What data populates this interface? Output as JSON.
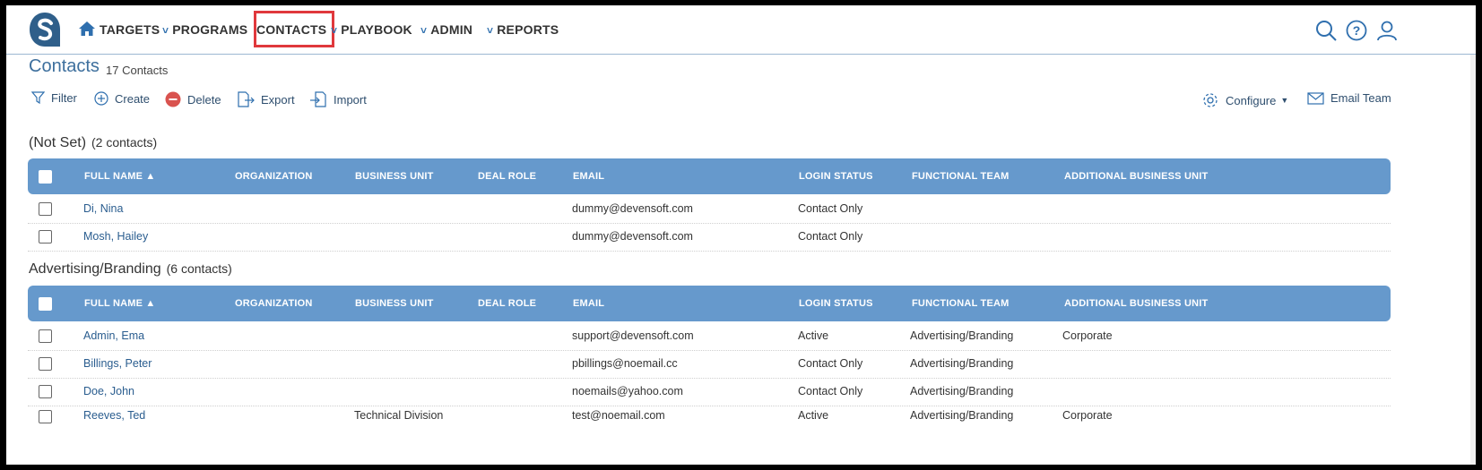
{
  "nav": {
    "items": [
      {
        "label": "TARGETS",
        "chevron": false
      },
      {
        "label": "PROGRAMS",
        "chevron": true
      },
      {
        "label": "CONTACTS",
        "chevron": false,
        "active": true
      },
      {
        "label": "PLAYBOOK",
        "chevron": true
      },
      {
        "label": "ADMIN",
        "chevron": true
      },
      {
        "label": "REPORTS",
        "chevron": true
      }
    ],
    "right_icons": [
      "search-icon",
      "help-icon",
      "user-icon"
    ],
    "highlight_color": "#e0383c"
  },
  "page": {
    "title": "Contacts",
    "count": "17 Contacts"
  },
  "toolbar": {
    "filter": "Filter",
    "create": "Create",
    "delete": "Delete",
    "export": "Export",
    "import": "Import",
    "configure": "Configure",
    "email_team": "Email Team"
  },
  "columns": {
    "full_name": "FULL NAME",
    "organization": "ORGANIZATION",
    "business_unit": "BUSINESS UNIT",
    "deal_role": "DEAL ROLE",
    "email": "EMAIL",
    "login_status": "LOGIN STATUS",
    "functional_team": "FUNCTIONAL TEAM",
    "additional_business_unit": "ADDITIONAL BUSINESS UNIT"
  },
  "groups": [
    {
      "name": "(Not Set)",
      "count": "(2 contacts)",
      "rows": [
        {
          "name": "Di, Nina",
          "org": "",
          "bu": "",
          "role": "",
          "email": "dummy@devensoft.com",
          "status": "Contact Only",
          "team": "",
          "abu": ""
        },
        {
          "name": "Mosh, Hailey",
          "org": "",
          "bu": "",
          "role": "",
          "email": "dummy@devensoft.com",
          "status": "Contact Only",
          "team": "",
          "abu": ""
        }
      ]
    },
    {
      "name": "Advertising/Branding",
      "count": "(6 contacts)",
      "rows": [
        {
          "name": "Admin, Ema",
          "org": "",
          "bu": "",
          "role": "",
          "email": "support@devensoft.com",
          "status": "Active",
          "team": "Advertising/Branding",
          "abu": "Corporate"
        },
        {
          "name": "Billings, Peter",
          "org": "",
          "bu": "",
          "role": "",
          "email": "pbillings@noemail.cc",
          "status": "Contact Only",
          "team": "Advertising/Branding",
          "abu": ""
        },
        {
          "name": "Doe, John",
          "org": "",
          "bu": "",
          "role": "",
          "email": "noemails@yahoo.com",
          "status": "Contact Only",
          "team": "Advertising/Branding",
          "abu": ""
        },
        {
          "name": "Reeves, Ted",
          "org": "",
          "bu": "Technical Division",
          "role": "",
          "email": "test@noemail.com",
          "status": "Active",
          "team": "Advertising/Branding",
          "abu": "Corporate"
        }
      ]
    }
  ]
}
